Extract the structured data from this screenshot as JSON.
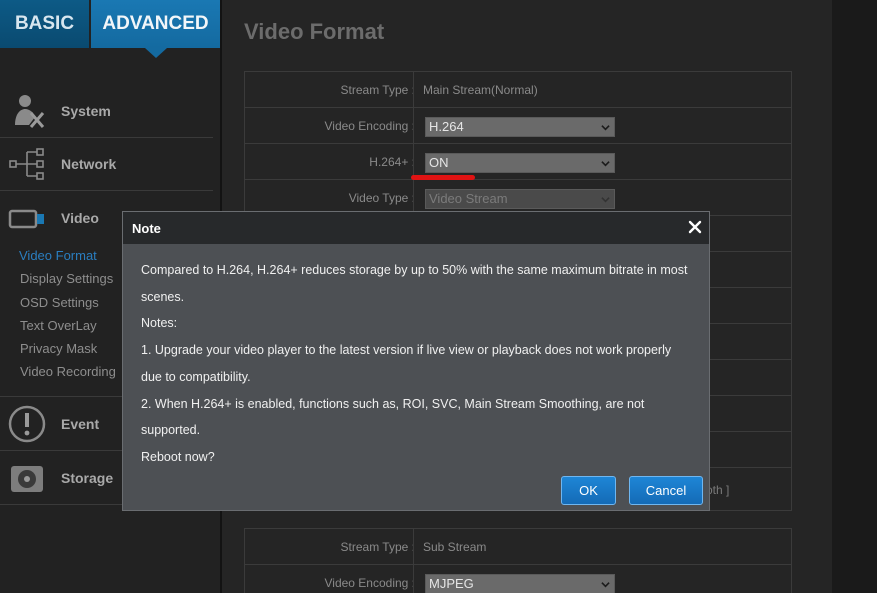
{
  "sidebar": {
    "tabs": {
      "basic": "BASIC",
      "advanced": "ADVANCED"
    },
    "menu": [
      {
        "label": "System",
        "icon": "system-tools-icon"
      },
      {
        "label": "Network",
        "icon": "network-tree-icon"
      },
      {
        "label": "Video",
        "icon": "video-camera-icon"
      },
      {
        "label": "Event",
        "icon": "alert-icon"
      },
      {
        "label": "Storage",
        "icon": "storage-disk-icon"
      }
    ],
    "submenu": [
      {
        "label": "Video Format",
        "active": true
      },
      {
        "label": "Display Settings"
      },
      {
        "label": "OSD Settings"
      },
      {
        "label": "Text OverLay"
      },
      {
        "label": "Privacy Mask"
      },
      {
        "label": "Video Recording"
      }
    ]
  },
  "main": {
    "title": "Video Format",
    "main_stream": {
      "stream_type_label": "Stream Type :",
      "stream_type_value": "Main Stream(Normal)",
      "video_encoding_label": "Video Encoding :",
      "video_encoding_value": "H.264",
      "h264plus_label": "H.264+ :",
      "h264plus_value": "ON",
      "video_type_label": "Video Type :",
      "video_type_value": "Video Stream"
    },
    "trailing_text": "oth ]",
    "sub_stream": {
      "stream_type_label": "Stream Type :",
      "stream_type_value": "Sub Stream",
      "video_encoding_label": "Video Encoding :",
      "video_encoding_value": "MJPEG"
    }
  },
  "modal": {
    "title": "Note",
    "close_symbol": "✕",
    "lines": [
      "Compared to H.264, H.264+ reduces storage by up to 50% with the same maximum bitrate in most",
      "scenes.",
      "Notes:",
      "1. Upgrade your video player to the latest version if live view or playback does not work properly",
      "due to compatibility.",
      "2. When H.264+ is enabled, functions such as, ROI, SVC, Main Stream Smoothing, are not",
      "supported.",
      "Reboot now?"
    ],
    "ok_label": "OK",
    "cancel_label": "Cancel"
  },
  "colors": {
    "accent": "#1a78b3",
    "highlight": "#e01313",
    "active_submenu": "#2a7ec0"
  }
}
